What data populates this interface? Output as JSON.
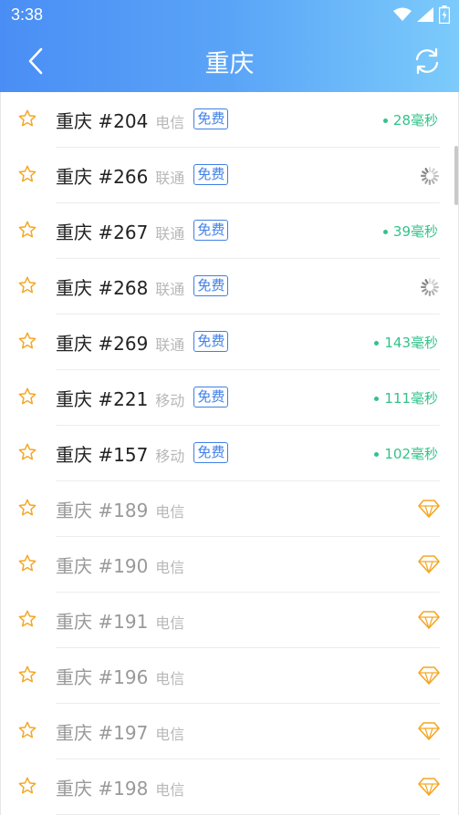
{
  "status": {
    "time": "3:38"
  },
  "header": {
    "title": "重庆"
  },
  "servers": [
    {
      "name": "重庆 #204",
      "isp": "电信",
      "badge": "免费",
      "latency": "28毫秒",
      "state": "ok"
    },
    {
      "name": "重庆 #266",
      "isp": "联通",
      "badge": "免费",
      "latency": "",
      "state": "loading"
    },
    {
      "name": "重庆 #267",
      "isp": "联通",
      "badge": "免费",
      "latency": "39毫秒",
      "state": "ok"
    },
    {
      "name": "重庆 #268",
      "isp": "联通",
      "badge": "免费",
      "latency": "",
      "state": "loading"
    },
    {
      "name": "重庆 #269",
      "isp": "联通",
      "badge": "免费",
      "latency": "143毫秒",
      "state": "ok"
    },
    {
      "name": "重庆 #221",
      "isp": "移动",
      "badge": "免费",
      "latency": "111毫秒",
      "state": "ok"
    },
    {
      "name": "重庆 #157",
      "isp": "移动",
      "badge": "免费",
      "latency": "102毫秒",
      "state": "ok"
    },
    {
      "name": "重庆 #189",
      "isp": "电信",
      "badge": "",
      "latency": "",
      "state": "vip"
    },
    {
      "name": "重庆 #190",
      "isp": "电信",
      "badge": "",
      "latency": "",
      "state": "vip"
    },
    {
      "name": "重庆 #191",
      "isp": "电信",
      "badge": "",
      "latency": "",
      "state": "vip"
    },
    {
      "name": "重庆 #196",
      "isp": "电信",
      "badge": "",
      "latency": "",
      "state": "vip"
    },
    {
      "name": "重庆 #197",
      "isp": "电信",
      "badge": "",
      "latency": "",
      "state": "vip"
    },
    {
      "name": "重庆 #198",
      "isp": "电信",
      "badge": "",
      "latency": "",
      "state": "vip"
    }
  ],
  "colors": {
    "header_start": "#4a8ef5",
    "header_end": "#7ccbfb",
    "star": "#f5a623",
    "badge": "#3f7fe6",
    "latency": "#33c28a",
    "vip": "#f5a623"
  },
  "icons": {
    "back": "chevron-left-icon",
    "refresh": "refresh-icon",
    "favorite": "star-outline-icon",
    "loading": "spinner-icon",
    "vip": "diamond-icon"
  }
}
